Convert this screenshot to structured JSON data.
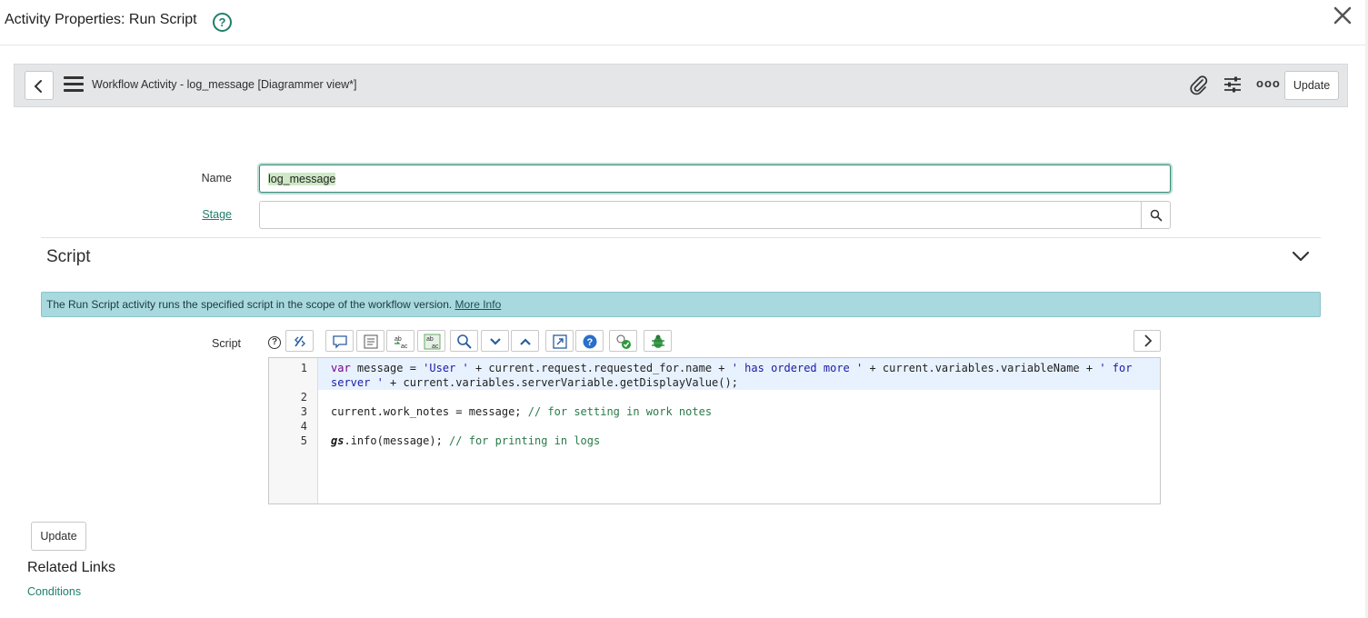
{
  "dialog": {
    "title": "Activity Properties: Run Script",
    "help_glyph": "?",
    "close_glyph": "✕"
  },
  "form_header": {
    "back_glyph": "‹",
    "title": "Workflow Activity - log_message [Diagrammer view*]",
    "more_glyph": "ooo",
    "update_label": "Update"
  },
  "fields": {
    "name_label": "Name",
    "name_value": "log_message",
    "stage_label": "Stage",
    "stage_value": ""
  },
  "script_section": {
    "title": "Script",
    "info_text": "The Run Script activity runs the specified script in the scope of the workflow version.",
    "info_link": "More Info",
    "script_label": "Script",
    "help_glyph": "?"
  },
  "toolbar_icons": [
    "format-icon",
    "comment-icon",
    "align-icon",
    "replace-icon",
    "replace-all-icon",
    "search-icon",
    "chevron-down-icon",
    "chevron-up-icon",
    "fullscreen-icon",
    "help-icon",
    "check-syntax-icon",
    "debug-icon"
  ],
  "editor": {
    "line_numbers": [
      "1",
      "2",
      "3",
      "4",
      "5"
    ],
    "line1a_kw": "var",
    "line1a_rest_1": " message = ",
    "line1a_str_1": "'User '",
    "line1a_rest_2": " + current.request.requested_for.name + ",
    "line1a_str_2": "' has ordered more '",
    "line1a_rest_3": " + current.variables.variableName + ",
    "line1a_str_3": "' for",
    "line1b_str": "server '",
    "line1b_rest": " + current.variables.serverVariable.getDisplayValue();",
    "line3_code": "current.work_notes = message; ",
    "line3_comment": "// for setting in work notes",
    "line5_obj": "gs",
    "line5_code": ".info(message); ",
    "line5_comment": "// for printing in logs"
  },
  "footer": {
    "update_label": "Update",
    "related_title": "Related Links",
    "conditions_link": "Conditions"
  },
  "colors": {
    "accent": "#1f7f6b",
    "info_bar": "#a8d9de",
    "header_bar": "#e4e6e7"
  }
}
